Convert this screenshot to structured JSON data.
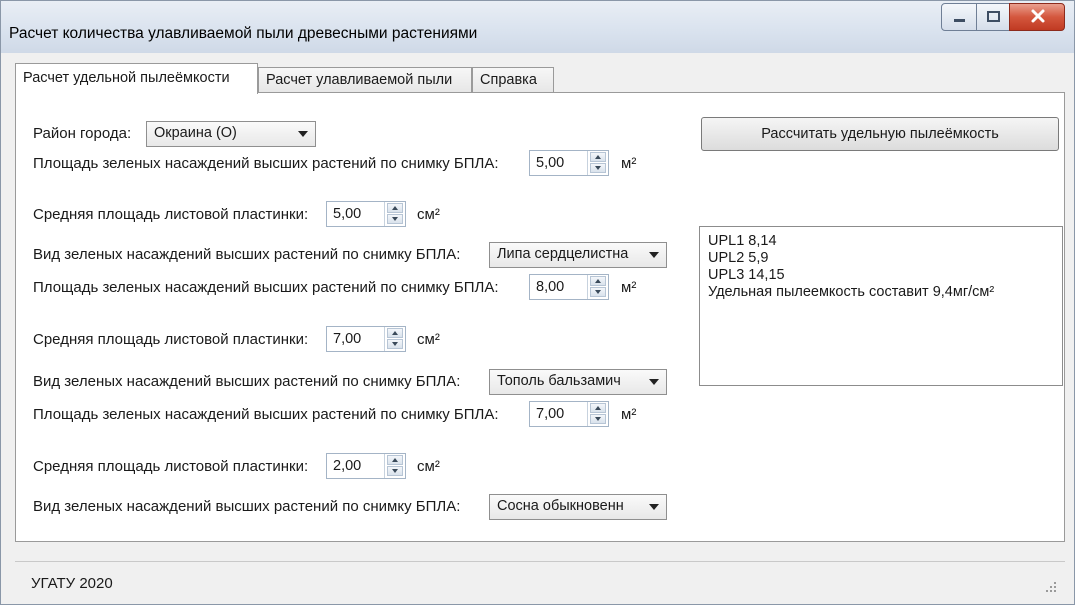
{
  "window": {
    "title": "Расчет количества улавливаемой пыли древесными растениями",
    "controls": [
      "minimize",
      "maximize",
      "close"
    ]
  },
  "tabs": [
    {
      "label": "Расчет удельной пылеёмкости",
      "active": true
    },
    {
      "label": "Расчет улавливаемой пыли",
      "active": false
    },
    {
      "label": "Справка",
      "active": false
    }
  ],
  "form": {
    "district_label": "Район города:",
    "district_value": "Окраина (О)",
    "groups": [
      {
        "area_label": "Площадь зеленых насаждений высших растений по снимку БПЛА:",
        "area_value": "5,00",
        "area_unit": "м²",
        "leaf_label": "Средняя площадь листовой пластинки:",
        "leaf_value": "5,00",
        "leaf_unit": "см²",
        "species_label": "Вид зеленых насаждений высших растений по снимку БПЛА:",
        "species_value": "Липа сердцелистна"
      },
      {
        "area_label": "Площадь зеленых насаждений высших растений по снимку БПЛА:",
        "area_value": "8,00",
        "area_unit": "м²",
        "leaf_label": "Средняя площадь листовой пластинки:",
        "leaf_value": "7,00",
        "leaf_unit": "см²",
        "species_label": "Вид зеленых насаждений высших растений по снимку БПЛА:",
        "species_value": "Тополь бальзамич"
      },
      {
        "area_label": "Площадь зеленых насаждений высших растений по снимку БПЛА:",
        "area_value": "7,00",
        "area_unit": "м²",
        "leaf_label": "Средняя площадь листовой пластинки:",
        "leaf_value": "2,00",
        "leaf_unit": "см²",
        "species_label": "Вид зеленых насаждений высших растений по снимку БПЛА:",
        "species_value": "Сосна обыкновенн"
      }
    ]
  },
  "calc_button_label": "Рассчитать удельную пылеёмкость",
  "results": [
    "UPL1 8,14",
    "UPL2 5,9",
    "UPL3 14,15",
    "Удельная пылеемкость составит  9,4мг/см²"
  ],
  "status": "УГАТУ 2020"
}
